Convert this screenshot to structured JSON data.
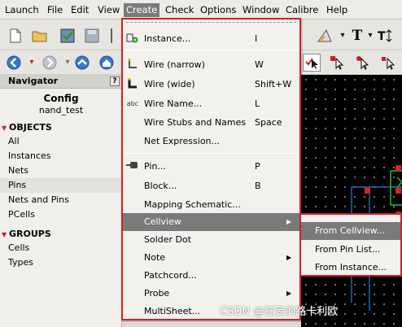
{
  "menubar": {
    "items": [
      "Launch",
      "File",
      "Edit",
      "View",
      "Create",
      "Check",
      "Options",
      "Window",
      "Calibre",
      "Help"
    ],
    "active": "Create"
  },
  "navigator": {
    "header": "Navigator",
    "help_button": "?",
    "title": "Config",
    "subtitle": "nand_test",
    "objects_label": "OBJECTS",
    "objects": [
      "All",
      "Instances",
      "Nets",
      "Pins",
      "Nets and Pins",
      "PCells"
    ],
    "selected_object": "Pins",
    "groups_label": "GROUPS",
    "groups": [
      "Cells",
      "Types"
    ]
  },
  "create_menu": {
    "items": [
      {
        "label": "Instance...",
        "shortcut": "I",
        "icon": "instance-icon"
      },
      {
        "label": "Wire (narrow)",
        "shortcut": "W",
        "icon": "wire-narrow-icon"
      },
      {
        "label": "Wire (wide)",
        "shortcut": "Shift+W",
        "icon": "wire-wide-icon"
      },
      {
        "label": "Wire Name...",
        "shortcut": "L",
        "icon": "wire-name-icon"
      },
      {
        "label": "Wire Stubs and Names",
        "shortcut": "Space"
      },
      {
        "label": "Net Expression..."
      },
      {
        "label": "Pin...",
        "shortcut": "P",
        "icon": "pin-icon"
      },
      {
        "label": "Block...",
        "shortcut": "B"
      },
      {
        "label": "Mapping Schematic..."
      },
      {
        "label": "Cellview",
        "submenu": true
      },
      {
        "label": "Solder Dot"
      },
      {
        "label": "Note",
        "submenu": true
      },
      {
        "label": "Patchcord..."
      },
      {
        "label": "Probe",
        "submenu": true
      },
      {
        "label": "MultiSheet..."
      }
    ],
    "highlighted": "Cellview"
  },
  "cellview_submenu": {
    "items": [
      "From Cellview...",
      "From Pin List...",
      "From Instance..."
    ],
    "highlighted": "From Cellview..."
  },
  "watermark": "CSDN @狂妄的路卡利欧",
  "colors": {
    "highlight": "#7a7a7a",
    "menu_border": "#d42020",
    "canvas": "#000000"
  }
}
